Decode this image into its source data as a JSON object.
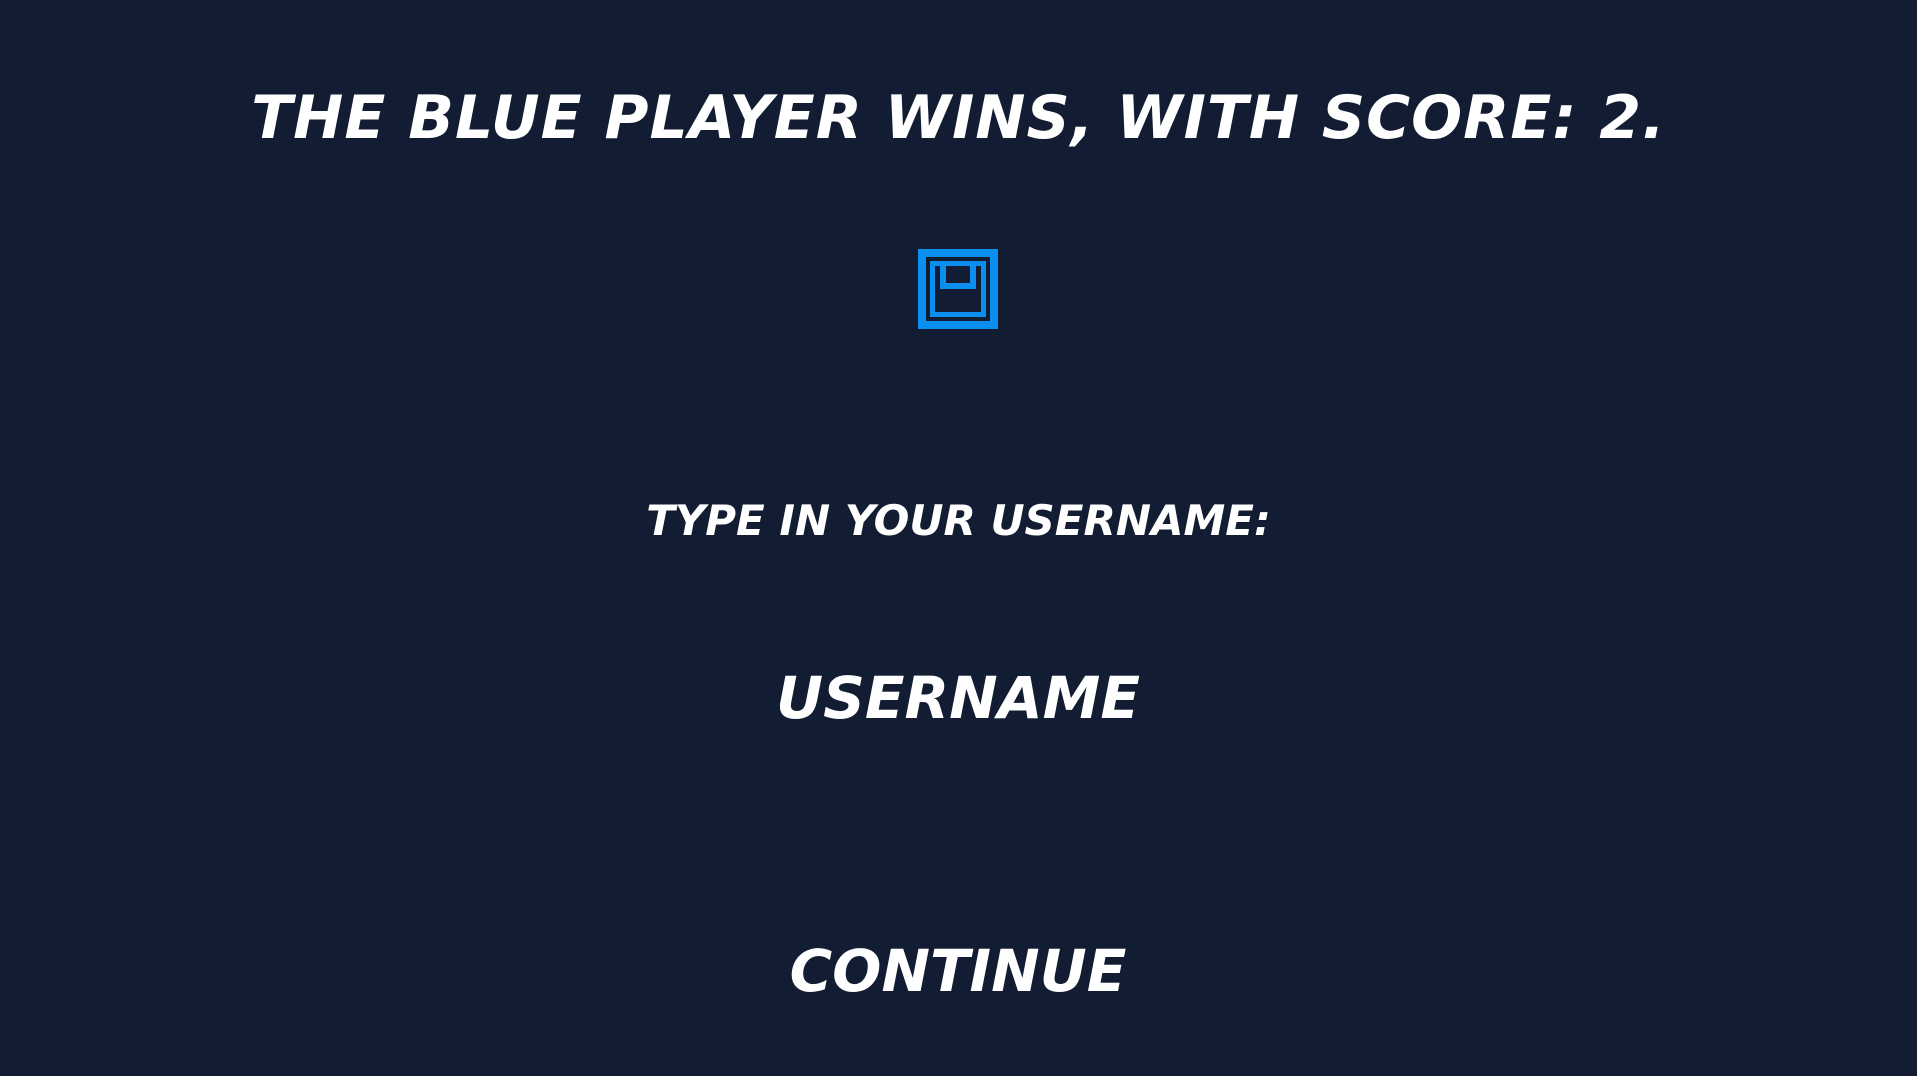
{
  "result": {
    "title": "THE BLUE PLAYER WINS, WITH SCORE: 2."
  },
  "player": {
    "icon": "blue-player-square-icon",
    "color": "#0a8ff0"
  },
  "form": {
    "prompt": "TYPE IN YOUR USERNAME:",
    "username_value": "",
    "username_placeholder": "USERNAME",
    "continue_label": "CONTINUE"
  },
  "colors": {
    "background": "#121d33",
    "text": "#ffffff",
    "player_blue": "#0a8ff0"
  }
}
